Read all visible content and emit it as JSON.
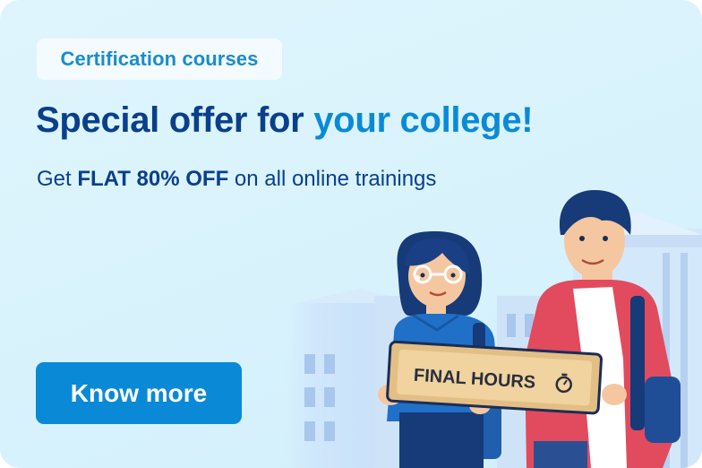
{
  "badge": {
    "label": "Certification courses"
  },
  "headline": {
    "part1": "Special offer for ",
    "highlight": "your college!"
  },
  "subline": {
    "prefix": "Get ",
    "strong": "FLAT 80% OFF",
    "suffix": " on all online trainings"
  },
  "cta": {
    "label": "Know more"
  },
  "sign": {
    "text": "FINAL HOURS"
  },
  "colors": {
    "accent": "#0a8ad6",
    "navy": "#0a3f8a",
    "background": "#d7f2fc"
  },
  "icons": [
    "stopwatch-icon"
  ]
}
